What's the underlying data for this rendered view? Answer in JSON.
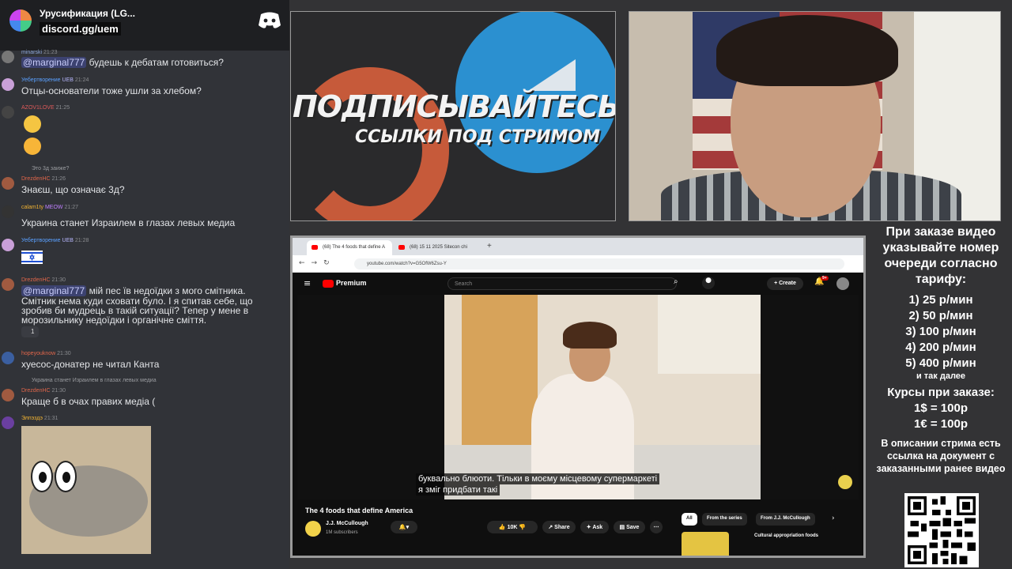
{
  "discord": {
    "server_name": "Урусификация (LG...",
    "invite": "discord.gg/uem",
    "messages": [
      {
        "user": "minarski",
        "time": "21:23",
        "text_mention": "@marginal777",
        "text": " будешь к дебатам готовиться?"
      },
      {
        "user": "Уебертворение",
        "badge": "UEB",
        "time": "21:24",
        "text": "Отцы-основатели тоже ушли за хлебом?"
      },
      {
        "user": "AZOV1LOVE",
        "time": "21:25"
      },
      {
        "reply": "Это 3д заиже?",
        "user": "DrezdenHC",
        "time": "21:26",
        "text": "Знаєш, що означає 3д?"
      },
      {
        "user": "calam1ty",
        "badge": "MEOW",
        "time": "21:27",
        "text": "Украина станет Израилем в глазах левых медиа"
      },
      {
        "user": "Уебертворение",
        "badge": "UEB",
        "time": "21:28"
      },
      {
        "user": "DrezdenHC",
        "time": "21:30",
        "text_mention": "@marginal777",
        "text": " мій пес їв недоїдки з мого смітника.",
        "text2": "Смітник нема куди сховати було. І я спитав себе, що",
        "text3": "зробив би мудрець в такій ситуації? Тепер у мене в",
        "text4": "морозильнику недоїдки і органічне сміття.",
        "reaction": "1"
      },
      {
        "user": "hopeyouknow",
        "time": "21:30",
        "text": "хуесос-донатер не читал Канта"
      },
      {
        "reply": "Украина станет Израилем в глазах левых медиа",
        "user": "DrezdenHC",
        "time": "21:30",
        "text": "Краще б в очах правих медіа ("
      },
      {
        "user": "Элпэздэ",
        "time": "21:31"
      }
    ]
  },
  "promo": {
    "line1": "ПОДПИСЫВАЙТЕСЬ",
    "line2": "ССЫЛКИ ПОД СТРИМОМ"
  },
  "browser": {
    "tab1": "(68) The 4 foods that define A",
    "tab2": "(68) 15 11 2025 Sitecon chi",
    "url": "youtube.com/watch?v=G5OfW6Zsu-Y",
    "brand": "Premium",
    "search_placeholder": "Search",
    "create": "+ Create",
    "notif": "9+",
    "subtitle1": "буквально блюоти. Тільки в моєму місцевому супермаркеті",
    "subtitle2": "я зміг придбати такі",
    "video_title": "The 4 foods that define America",
    "channel": "J.J. McCullough",
    "subs": "1M subscribers",
    "likes": "10K",
    "share": "Share",
    "ask": "Ask",
    "save": "Save",
    "chips": [
      "All",
      "From the series",
      "From J.J. McCullough"
    ],
    "rec_title": "Cultural appropriation foods"
  },
  "info": {
    "header": "При заказе видео указывайте номер очереди согласно тарифу:",
    "tariffs": [
      "1) 25 р/мин",
      "2) 50 р/мин",
      "3) 100 р/мин",
      "4) 200 р/мин",
      "5) 400 р/мин"
    ],
    "etc": "и так далее",
    "rates_title": "Курсы при заказе:",
    "rates": [
      "1$ = 100р",
      "1€ = 100р"
    ],
    "note": "В описании стрима есть ссылка на документ с заказанными ранее видео"
  }
}
